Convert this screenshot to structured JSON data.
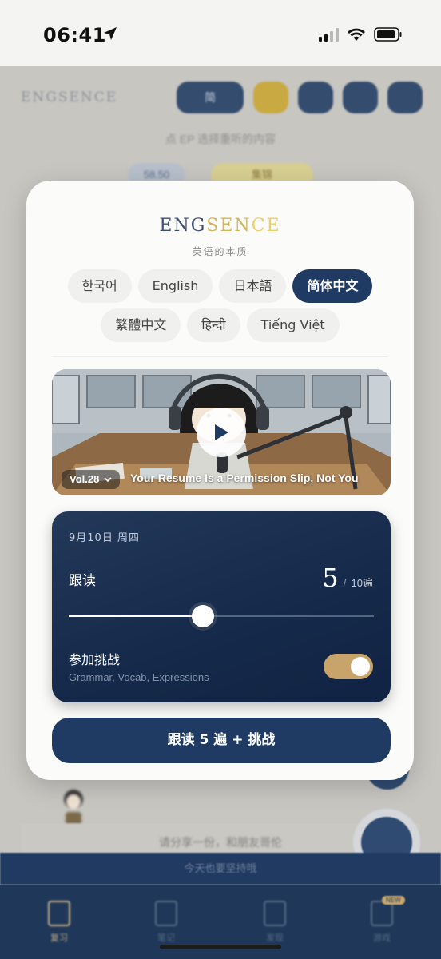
{
  "status_bar": {
    "time": "06:41"
  },
  "background": {
    "logo": "ENGSENCE",
    "lang_button": "简",
    "hint": "点 EP 选择重听的内容",
    "pill_left": "58.50",
    "pill_right": "集锦",
    "row_text": "请分享一份，和朋友哥伦",
    "banner": "今天也要坚持哦",
    "tabs": [
      {
        "label": "复习"
      },
      {
        "label": "笔记"
      },
      {
        "label": "发现"
      },
      {
        "label": "游戏",
        "badge": "NEW"
      }
    ]
  },
  "modal": {
    "brand": {
      "part1": "ENG",
      "part2": "SEN",
      "part3": "CE"
    },
    "subtitle": "英语的本质",
    "languages_row1": [
      "한국어",
      "English",
      "日本語",
      "简体中文"
    ],
    "languages_row2": [
      "繁體中文",
      "हिन्दी",
      "Tiếng Việt"
    ],
    "selected_language": "简体中文",
    "video": {
      "volume": "Vol.28",
      "title": "Your Resume Is a Permission Slip, Not You"
    },
    "panel": {
      "date": "9月10日  周四",
      "shadowing_label": "跟读",
      "count": "5",
      "total": "10遍",
      "progress": 0.44,
      "challenge_label": "参加挑战",
      "challenge_sub": "Grammar, Vocab, Expressions",
      "challenge_on": true
    },
    "cta_label": "跟读 5 遍 + 挑战"
  },
  "colors": {
    "navy": "#1f3b63",
    "gold": "#c8a46a",
    "card": "#fbfbfa"
  }
}
